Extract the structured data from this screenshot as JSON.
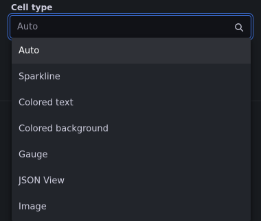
{
  "field": {
    "label": "Cell type",
    "placeholder": "Auto",
    "value": ""
  },
  "options": [
    {
      "label": "Auto",
      "selected": true
    },
    {
      "label": "Sparkline",
      "selected": false
    },
    {
      "label": "Colored text",
      "selected": false
    },
    {
      "label": "Colored background",
      "selected": false
    },
    {
      "label": "Gauge",
      "selected": false
    },
    {
      "label": "JSON View",
      "selected": false
    },
    {
      "label": "Image",
      "selected": false
    }
  ],
  "colors": {
    "background": "#111217",
    "panel": "#181b1f",
    "menu": "#22252b",
    "active_item": "#2f3137",
    "focus_border": "#3d71d9",
    "text": "#ccccdc",
    "placeholder": "#8e8e9e"
  },
  "icons": {
    "search": "search-icon"
  }
}
